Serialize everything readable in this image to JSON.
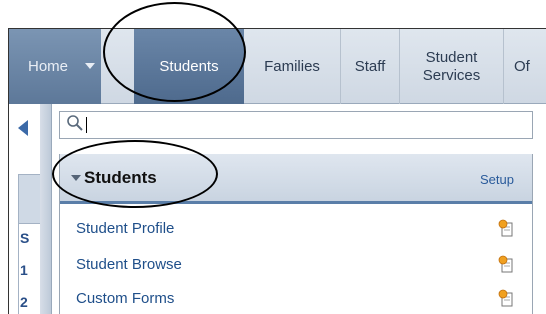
{
  "nav": {
    "tabs": [
      {
        "label": "Home"
      },
      {
        "label": "Students"
      },
      {
        "label": "Families"
      },
      {
        "label": "Staff"
      },
      {
        "label": "Student Services"
      },
      {
        "label": "Of"
      }
    ]
  },
  "search": {
    "placeholder": ""
  },
  "left_rail": {
    "letters": [
      "S",
      "1",
      "2"
    ]
  },
  "menu": {
    "title": "Students",
    "setup_label": "Setup",
    "items": [
      {
        "label": "Student Profile",
        "icon": "add-favorite-icon"
      },
      {
        "label": "Student Browse",
        "icon": "add-favorite-icon"
      },
      {
        "label": "Custom Forms",
        "icon": "add-favorite-icon"
      }
    ]
  },
  "colors": {
    "accent": "#4e6a8d",
    "link": "#1f4f8a",
    "header_bg": "#c9d4e1"
  }
}
